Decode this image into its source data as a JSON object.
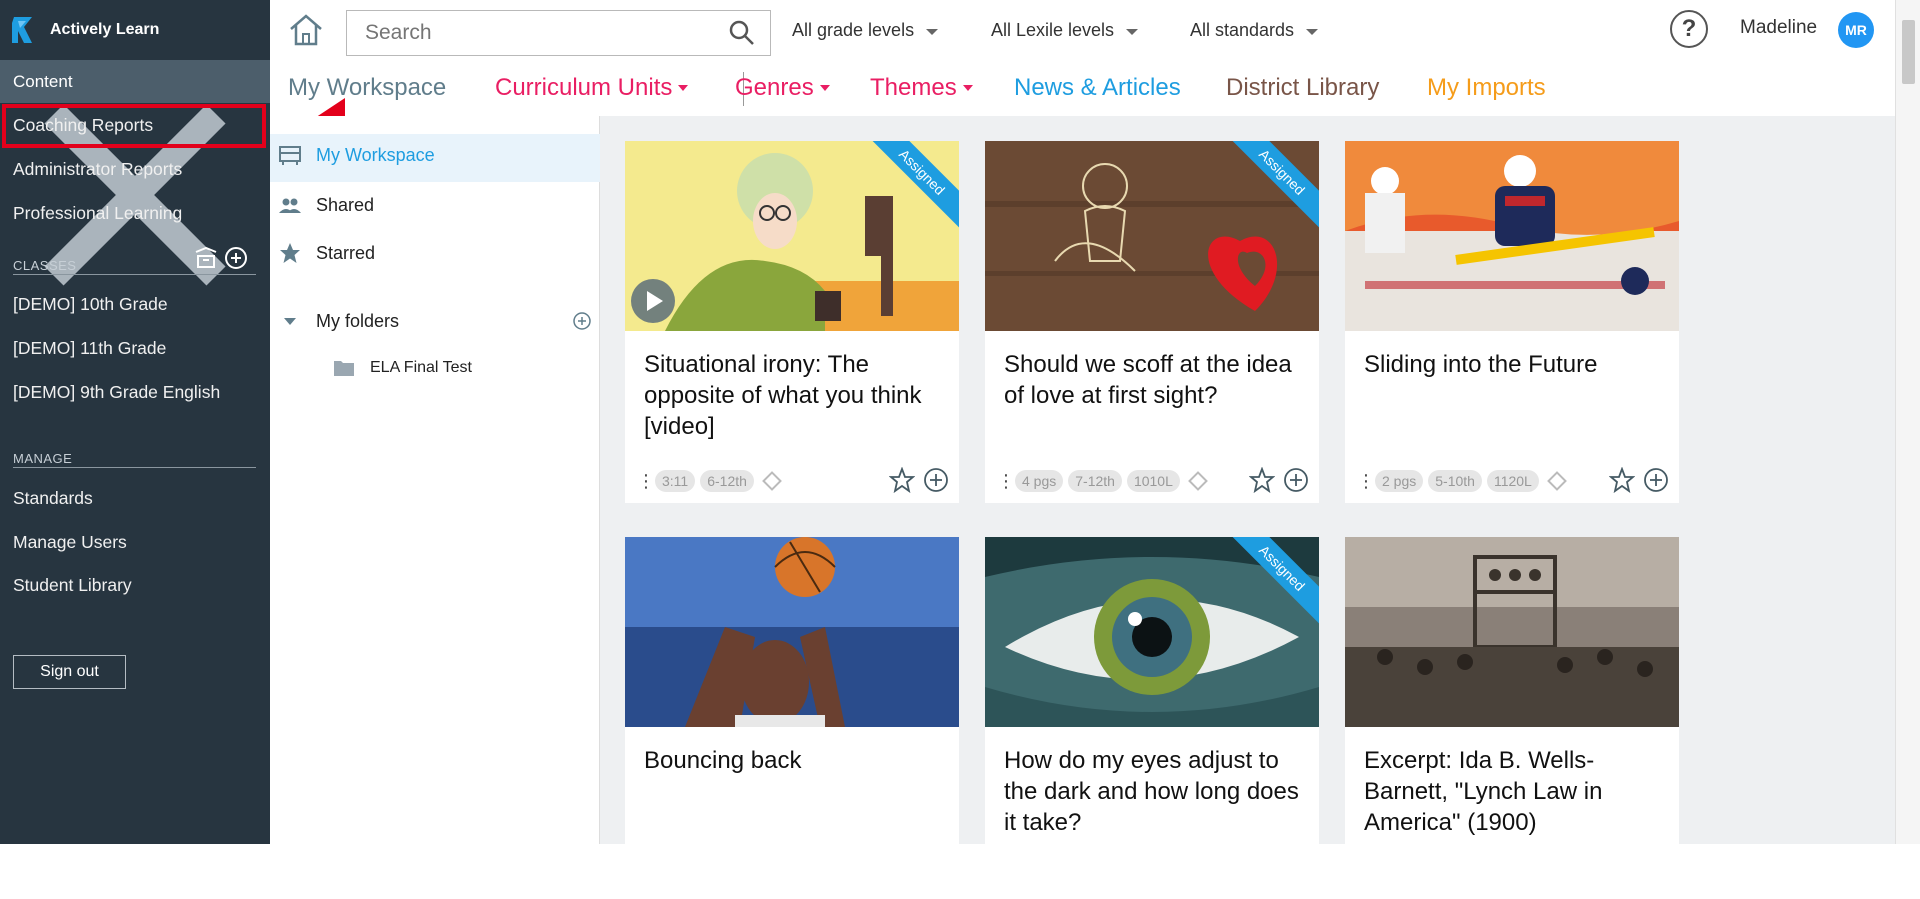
{
  "app": {
    "brand": "Actively Learn"
  },
  "sidebar": {
    "content_label": "Content",
    "nav": [
      {
        "label": "Coaching Reports"
      },
      {
        "label": "Administrator Reports"
      },
      {
        "label": "Professional Learning"
      }
    ],
    "classes_label": "CLASSES",
    "classes": [
      {
        "label": "[DEMO] 10th Grade"
      },
      {
        "label": "[DEMO] 11th Grade"
      },
      {
        "label": "[DEMO] 9th Grade English"
      }
    ],
    "manage_label": "MANAGE",
    "manage": [
      {
        "label": "Standards"
      },
      {
        "label": "Manage Users"
      },
      {
        "label": "Student Library"
      }
    ],
    "sign_out": "Sign out"
  },
  "header": {
    "search_placeholder": "Search",
    "filters": [
      "All grade levels",
      "All Lexile levels",
      "All standards"
    ],
    "help": "?",
    "user_name": "Madeline",
    "user_initials": "MR"
  },
  "tabs": [
    {
      "label": "My Workspace",
      "color": "#607d8b"
    },
    {
      "label": "Curriculum Units",
      "color": "#e91e63"
    },
    {
      "label": "Genres",
      "color": "#e91e63"
    },
    {
      "label": "Themes",
      "color": "#e91e63"
    },
    {
      "label": "News & Articles",
      "color": "#1e9de0"
    },
    {
      "label": "District Library",
      "color": "#795548"
    },
    {
      "label": "My Imports",
      "color": "#f59c1a"
    }
  ],
  "workspace_nav": {
    "my_workspace": "My Workspace",
    "shared": "Shared",
    "starred": "Starred",
    "my_folders": "My folders",
    "folders": [
      "ELA Final Test"
    ]
  },
  "cards": [
    {
      "title": "Situational irony: The opposite of what you think [video]",
      "assigned": "Assigned",
      "meta": [
        "3:11",
        "6-12th"
      ]
    },
    {
      "title": "Should we scoff at the idea of love at first sight?",
      "assigned": "Assigned",
      "meta": [
        "4 pgs",
        "7-12th",
        "1010L"
      ]
    },
    {
      "title": "Sliding into the Future",
      "assigned": "",
      "meta": [
        "2 pgs",
        "5-10th",
        "1120L"
      ]
    },
    {
      "title": "Bouncing back",
      "assigned": "",
      "meta": []
    },
    {
      "title": "How do my eyes adjust to the dark and how long does it take?",
      "assigned": "Assigned",
      "meta": []
    },
    {
      "title": "Excerpt: Ida B. Wells-Barnett, \"Lynch Law in America\" (1900)",
      "assigned": "",
      "meta": []
    }
  ],
  "colors": {
    "sidebar_bg": "#273540",
    "accent_blue": "#1e9de0",
    "highlight_red": "#e3001b"
  }
}
